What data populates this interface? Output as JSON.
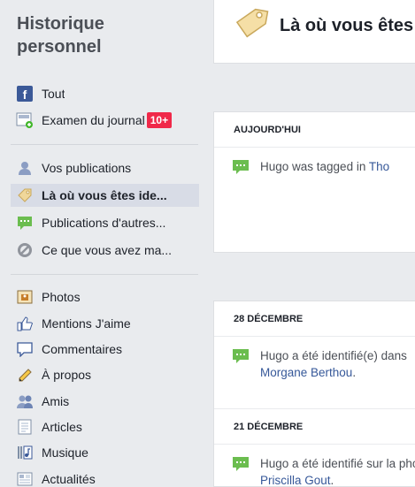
{
  "sidebar": {
    "title_line1": "Historique",
    "title_line2": "personnel",
    "items": [
      {
        "label": "Tout",
        "icon": "facebook-icon"
      },
      {
        "label": "Examen du journal",
        "badge": "10+",
        "icon": "timeline-review-icon"
      },
      {
        "label": "Vos publications",
        "icon": "person-icon"
      },
      {
        "label": "Là où vous êtes ide...",
        "icon": "tag-icon",
        "active": true
      },
      {
        "label": "Publications d'autres...",
        "icon": "speech-bubble-icon"
      },
      {
        "label": "Ce que vous avez ma...",
        "icon": "hidden-icon"
      },
      {
        "label": "Photos",
        "icon": "photo-icon"
      },
      {
        "label": "Mentions J'aime",
        "icon": "like-icon"
      },
      {
        "label": "Commentaires",
        "icon": "comment-icon"
      },
      {
        "label": "À propos",
        "icon": "pencil-icon"
      },
      {
        "label": "Amis",
        "icon": "friends-icon"
      },
      {
        "label": "Articles",
        "icon": "article-icon"
      },
      {
        "label": "Musique",
        "icon": "music-icon"
      },
      {
        "label": "Actualités",
        "icon": "news-icon"
      }
    ]
  },
  "main": {
    "header_title": "Là où vous êtes identifié(e)",
    "sections": [
      {
        "date": "AUJOURD'HUI",
        "text": "Hugo was tagged in ",
        "link": "Tho"
      },
      {
        "date": "28 DÉCEMBRE",
        "text": "Hugo a été identifié(e) dans",
        "link": "Morgane Berthou",
        "suffix": "."
      },
      {
        "date": "21 DÉCEMBRE",
        "text": "Hugo a été identifié sur la photo",
        "link": "Priscilla Gout",
        "suffix": "."
      }
    ]
  },
  "colors": {
    "background": "#e9ebee",
    "link": "#365899",
    "badge": "#f02849",
    "active_item": "#d8dce6",
    "story_icon": "#6bbd4f"
  }
}
